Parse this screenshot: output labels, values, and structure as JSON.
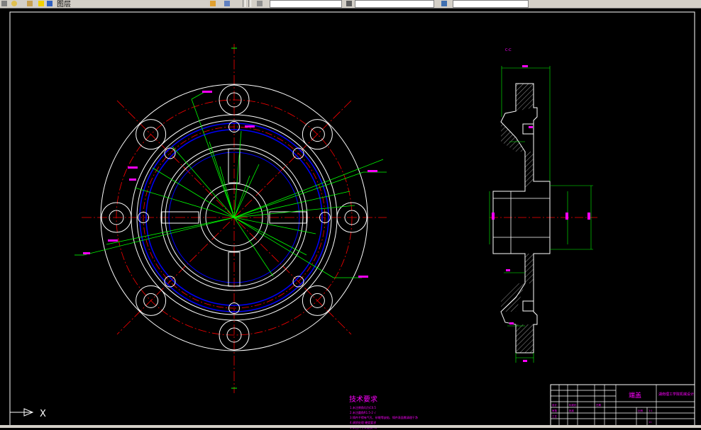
{
  "toolbar": {
    "layer_field": "图层",
    "icons": [
      "folder-icon",
      "layer-state-icon",
      "layer-props-icon",
      "color-icon",
      "linetype-icon",
      "lineweight-icon"
    ]
  },
  "drawing": {
    "colors": {
      "white": "#ffffff",
      "red": "#ff0000",
      "green": "#00ff00",
      "blue": "#0000ff",
      "magenta": "#ff00ff",
      "yellow": "#ffff00"
    },
    "section_label": "C-C",
    "tech_requirements": {
      "title": "技术要求",
      "lines": [
        "1.未注倒角均为C0.5",
        "2.未注圆角R1.5-2 √",
        "3.铸件不得有气孔、砂眼等缺陷、铸件表面需清理干净",
        "4.调质处理 硬度要求",
        "5.未注尺寸公差按IT8"
      ]
    },
    "title_block": {
      "part_name": "端盖",
      "school": "湖南理工学院机械设计",
      "cells": [
        "设计",
        "审核",
        "工艺",
        "标准化",
        "批准",
        "日期",
        "比例",
        "1:1"
      ],
      "scale": "1:1",
      "sheet": "11"
    }
  },
  "ucs": {
    "x_label": "X"
  }
}
